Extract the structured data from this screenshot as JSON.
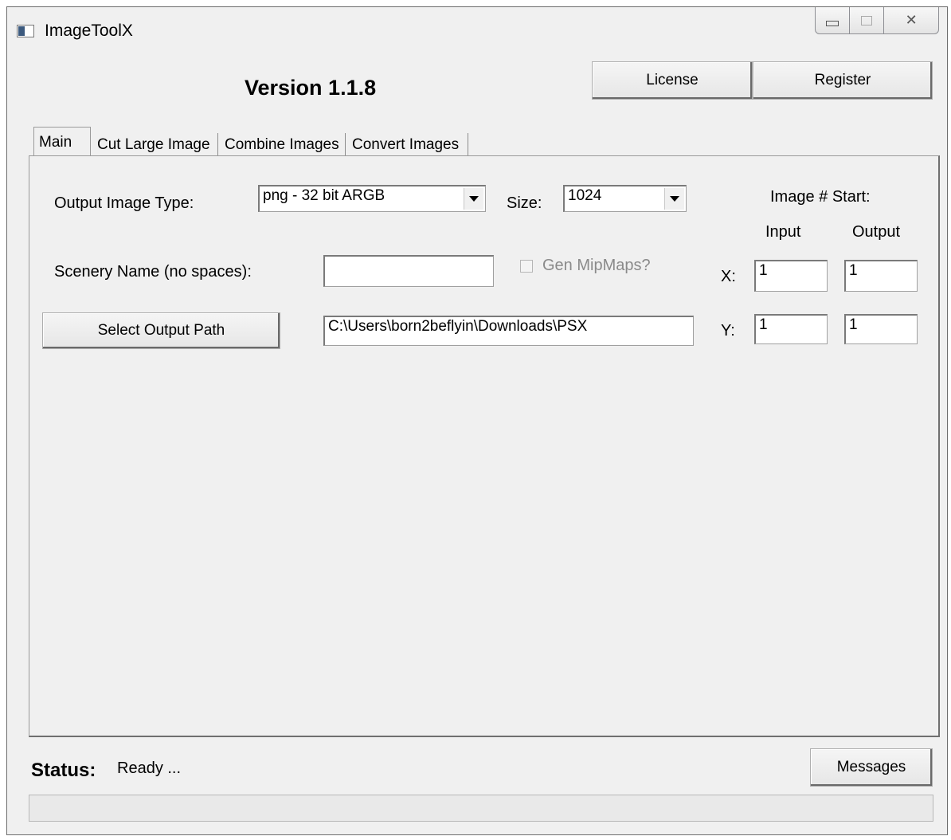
{
  "window": {
    "title": "ImageToolX",
    "controls": {
      "minimize": "minimize",
      "maximize": "maximize",
      "close": "✕"
    }
  },
  "header": {
    "version": "Version 1.1.8",
    "license_label": "License",
    "register_label": "Register"
  },
  "tabs": [
    {
      "label": "Main",
      "active": true
    },
    {
      "label": "Cut Large Image",
      "active": false
    },
    {
      "label": "Combine Images",
      "active": false
    },
    {
      "label": "Convert Images",
      "active": false
    }
  ],
  "main": {
    "output_type_label": "Output Image Type:",
    "output_type_value": "png - 32 bit ARGB",
    "size_label": "Size:",
    "size_value": "1024",
    "image_start_label": "Image # Start:",
    "input_header": "Input",
    "output_header": "Output",
    "scenery_label": "Scenery Name (no spaces):",
    "scenery_value": "",
    "mipmaps_label": "Gen MipMaps?",
    "mipmaps_checked": false,
    "x_label": "X:",
    "y_label": "Y:",
    "x_input": "1",
    "x_output": "1",
    "y_input": "1",
    "y_output": "1",
    "select_path_label": "Select Output Path",
    "output_path": "C:\\Users\\born2beflyin\\Downloads\\PSX"
  },
  "footer": {
    "status_label": "Status:",
    "status_text": "Ready ...",
    "messages_label": "Messages",
    "progress": 0
  }
}
